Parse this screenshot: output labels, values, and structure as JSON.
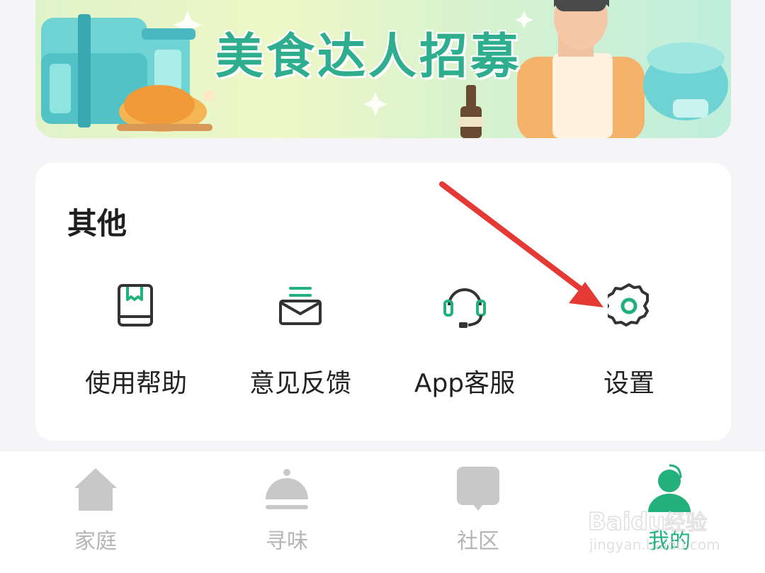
{
  "banner": {
    "title": "美食达人招募"
  },
  "section": {
    "title": "其他",
    "items": [
      {
        "label": "使用帮助",
        "icon": "help-book-icon"
      },
      {
        "label": "意见反馈",
        "icon": "feedback-envelope-icon"
      },
      {
        "label": "App客服",
        "icon": "headset-icon"
      },
      {
        "label": "设置",
        "icon": "gear-icon"
      }
    ]
  },
  "bottom_nav": {
    "items": [
      {
        "label": "家庭",
        "icon": "home-icon",
        "active": false
      },
      {
        "label": "寻味",
        "icon": "dish-cloche-icon",
        "active": false
      },
      {
        "label": "社区",
        "icon": "chat-bubble-icon",
        "active": false
      },
      {
        "label": "我的",
        "icon": "user-profile-icon",
        "active": true
      }
    ]
  },
  "colors": {
    "accent": "#22b07d",
    "icon_dark": "#333333",
    "nav_inactive": "#c8c8c8",
    "annotation": "#e53935"
  }
}
